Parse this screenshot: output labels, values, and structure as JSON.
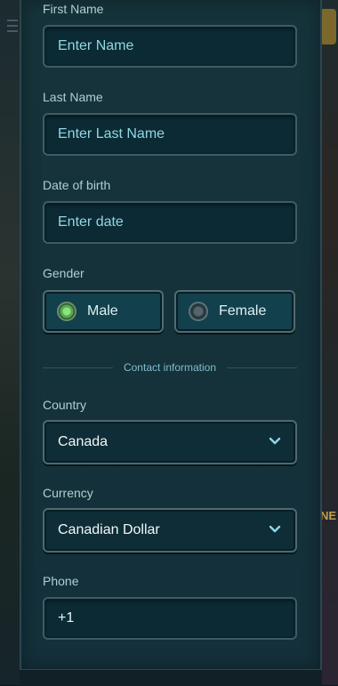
{
  "form": {
    "first_name": {
      "label": "First Name",
      "placeholder": "Enter Name"
    },
    "last_name": {
      "label": "Last Name",
      "placeholder": "Enter Last Name"
    },
    "dob": {
      "label": "Date of birth",
      "placeholder": "Enter date"
    },
    "gender": {
      "label": "Gender",
      "options": [
        {
          "label": "Male",
          "selected": true
        },
        {
          "label": "Female",
          "selected": false
        }
      ]
    },
    "contact_divider": "Contact information",
    "country": {
      "label": "Country",
      "value": "Canada"
    },
    "currency": {
      "label": "Currency",
      "value": "Canadian Dollar"
    },
    "phone": {
      "label": "Phone",
      "value": "+1"
    }
  },
  "background": {
    "side_text": "NE"
  },
  "colors": {
    "accent": "#8fd8e6",
    "panel": "#15313a",
    "radio_on": "#8be37d"
  },
  "icons": {
    "dropdown": "chevron-down-icon",
    "menu": "menu-icon"
  }
}
